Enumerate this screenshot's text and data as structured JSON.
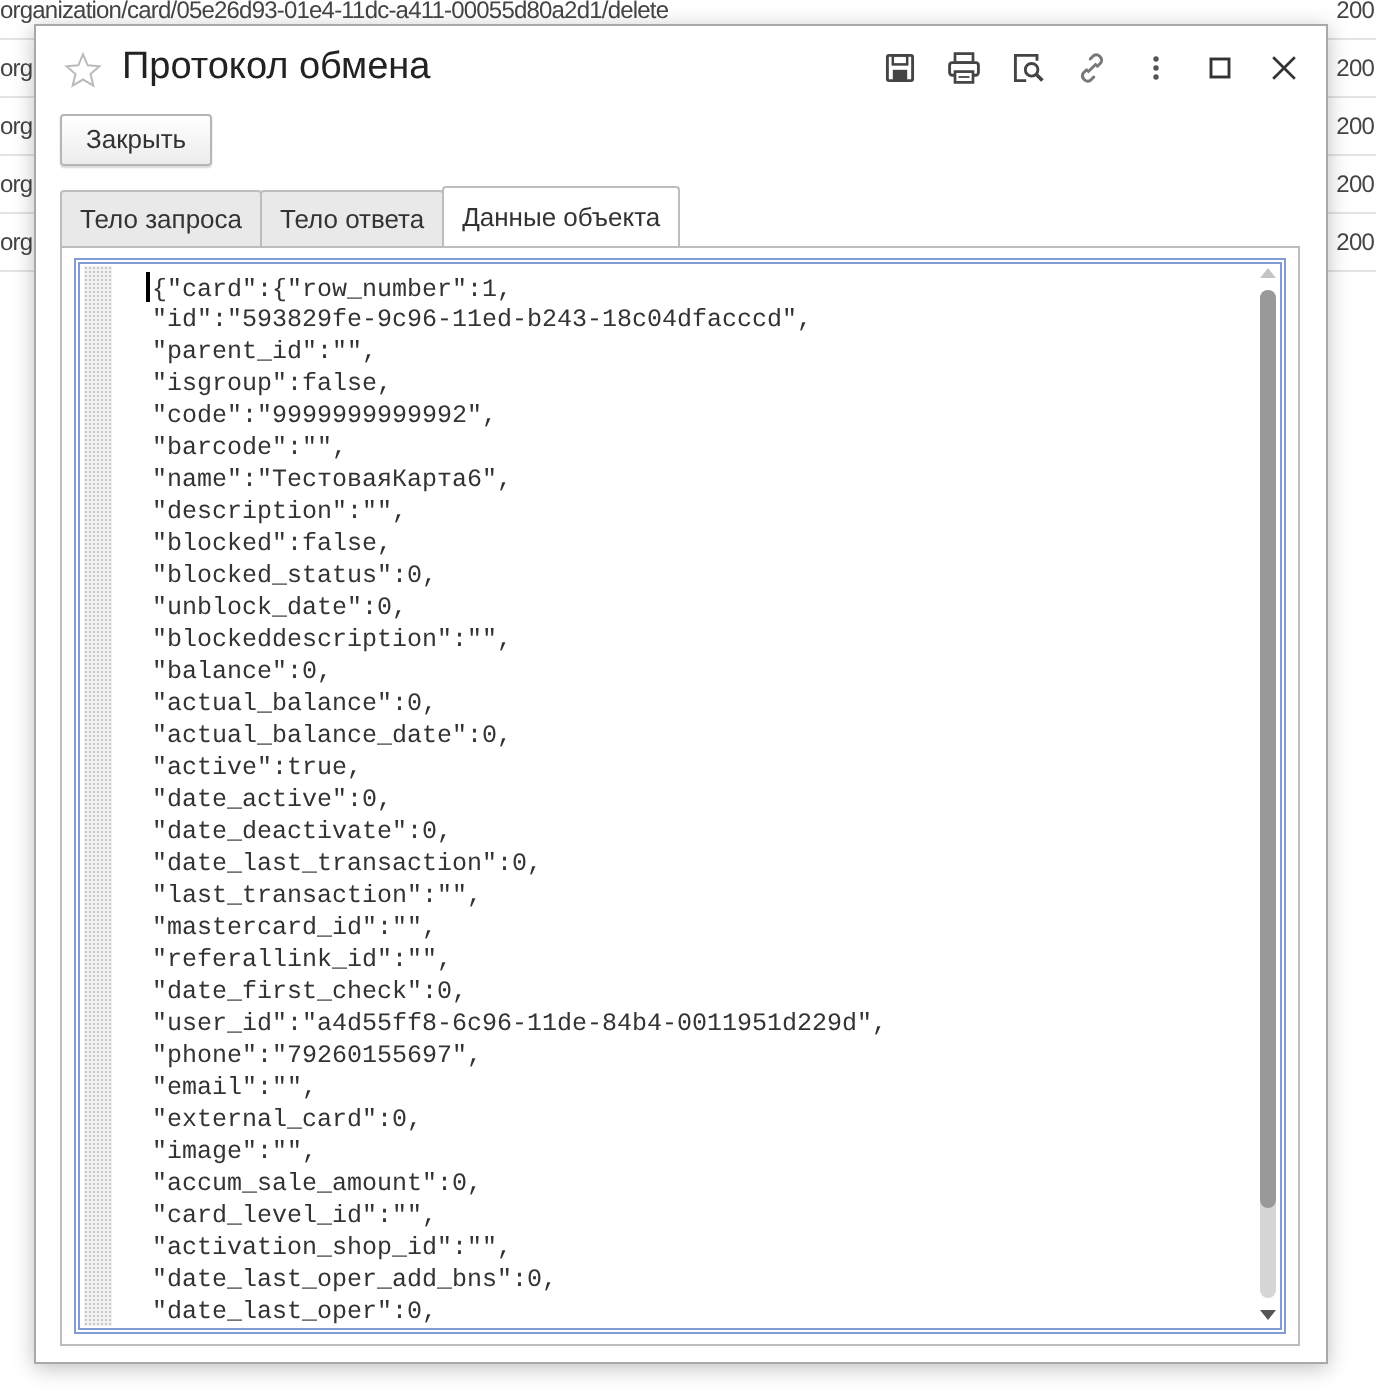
{
  "background_list": {
    "rows": [
      {
        "path": "organization/card/05e26d93-01e4-11dc-a411-00055d80a2d1/delete",
        "code": "200"
      },
      {
        "path": "org",
        "code": "200"
      },
      {
        "path": "org",
        "code": "200"
      },
      {
        "path": "org",
        "code": "200"
      },
      {
        "path": "org",
        "code": "200"
      }
    ]
  },
  "window": {
    "title": "Протокол обмена",
    "favorite": false,
    "toolbar_icons": [
      {
        "kind": "save"
      },
      {
        "kind": "print"
      },
      {
        "kind": "preview"
      },
      {
        "kind": "link"
      },
      {
        "kind": "more"
      },
      {
        "kind": "maximize"
      },
      {
        "kind": "close"
      }
    ]
  },
  "buttons": [
    {
      "label": "Закрыть"
    }
  ],
  "tabs": [
    {
      "label": "Тело запроса",
      "selected": false
    },
    {
      "label": "Тело ответа",
      "selected": false
    },
    {
      "label": "Данные объекта",
      "selected": true
    }
  ],
  "editor": {
    "lines": [
      "{\"card\":{\"row_number\":1,",
      "\"id\":\"593829fe-9c96-11ed-b243-18c04dfacccd\",",
      "\"parent_id\":\"\",",
      "\"isgroup\":false,",
      "\"code\":\"9999999999992\",",
      "\"barcode\":\"\",",
      "\"name\":\"ТестоваяКарта6\",",
      "\"description\":\"\",",
      "\"blocked\":false,",
      "\"blocked_status\":0,",
      "\"unblock_date\":0,",
      "\"blockeddescription\":\"\",",
      "\"balance\":0,",
      "\"actual_balance\":0,",
      "\"actual_balance_date\":0,",
      "\"active\":true,",
      "\"date_active\":0,",
      "\"date_deactivate\":0,",
      "\"date_last_transaction\":0,",
      "\"last_transaction\":\"\",",
      "\"mastercard_id\":\"\",",
      "\"referallink_id\":\"\",",
      "\"date_first_check\":0,",
      "\"user_id\":\"a4d55ff8-6c96-11de-84b4-0011951d229d\",",
      "\"phone\":\"79260155697\",",
      "\"email\":\"\",",
      "\"external_card\":0,",
      "\"image\":\"\",",
      "\"accum_sale_amount\":0,",
      "\"card_level_id\":\"\",",
      "\"activation_shop_id\":\"\",",
      "\"date_last_oper_add_bns\":0,",
      "\"date_last_oper\":0,"
    ]
  }
}
